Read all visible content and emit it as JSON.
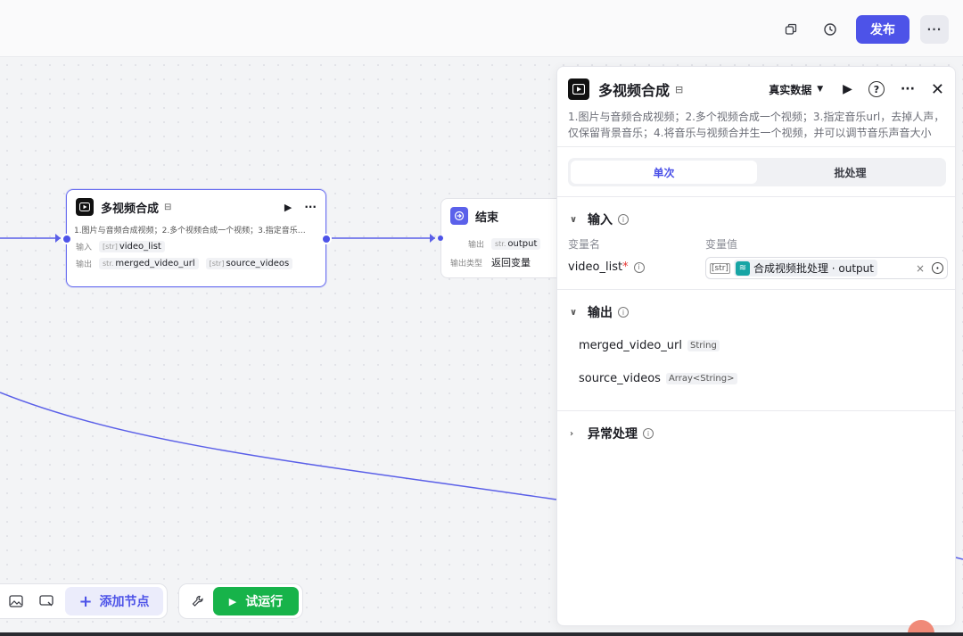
{
  "topbar": {
    "publish_label": "发布",
    "more_label": "···"
  },
  "workflow_node": {
    "title": "多视频合成",
    "description": "1.图片与音频合成视频；2.多个视频合成一个视频；3.指定音乐…",
    "input_label": "输入",
    "input_type": "[str]",
    "input_var": "video_list",
    "output_label": "输出",
    "outputs": [
      {
        "type": "str.",
        "name": "merged_video_url"
      },
      {
        "type": "[str]",
        "name": "source_videos"
      }
    ]
  },
  "end_node": {
    "title": "结束",
    "output_label": "输出",
    "output_type": "str.",
    "output_var": "output",
    "output_type_label": "输出类型",
    "output_type_value": "返回变量"
  },
  "panel": {
    "title": "多视频合成",
    "data_mode": "真实数据",
    "description": "1.图片与音频合成视频；2.多个视频合成一个视频；3.指定音乐url，去掉人声，仅保留背景音乐；4.将音乐与视频合并生一个视频，并可以调节音乐声音大小",
    "tabs": [
      "单次",
      "批处理"
    ],
    "input_section": "输入",
    "col_name": "变量名",
    "col_value": "变量值",
    "var_name": "video_list",
    "var_required": "*",
    "var_type": "[str]",
    "var_ref": "合成视频批处理 · output",
    "clear_icon": "×",
    "output_section": "输出",
    "outputs": [
      {
        "name": "merged_video_url",
        "type": "String"
      },
      {
        "name": "source_videos",
        "type": "Array<String>"
      }
    ],
    "exception_section": "异常处理"
  },
  "bottom_toolbar": {
    "add_node_label": "添加节点",
    "run_label": "试运行"
  },
  "colors": {
    "accent": "#4d53e8",
    "run_green": "#17b34a",
    "edge": "#5a5fe8"
  }
}
